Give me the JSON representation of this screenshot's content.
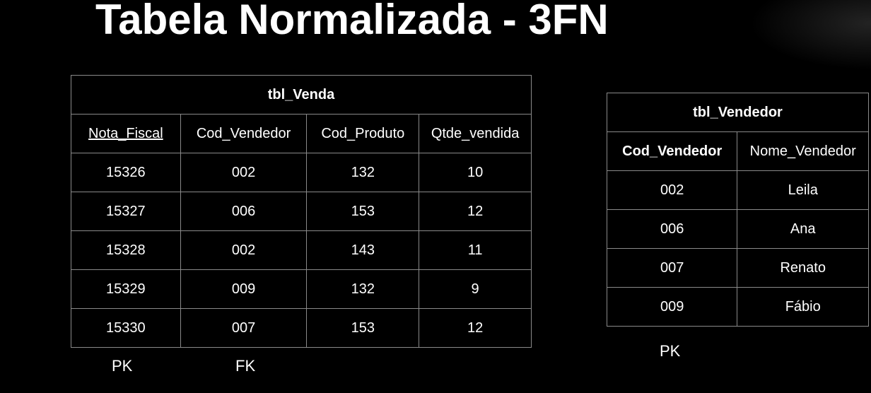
{
  "slide": {
    "title": "Tabela Normalizada - 3FN"
  },
  "tbl_venda": {
    "name": "tbl_Venda",
    "columns": [
      "Nota_Fiscal",
      "Cod_Vendedor",
      "Cod_Produto",
      "Qtde_vendida"
    ],
    "rows": [
      [
        "15326",
        "002",
        "132",
        "10"
      ],
      [
        "15327",
        "006",
        "153",
        "12"
      ],
      [
        "15328",
        "002",
        "143",
        "11"
      ],
      [
        "15329",
        "009",
        "132",
        "9"
      ],
      [
        "15330",
        "007",
        "153",
        "12"
      ]
    ],
    "pk_label": "PK",
    "fk_label": "FK"
  },
  "tbl_vendedor": {
    "name": "tbl_Vendedor",
    "columns": [
      "Cod_Vendedor",
      "Nome_Vendedor"
    ],
    "rows": [
      [
        "002",
        "Leila"
      ],
      [
        "006",
        "Ana"
      ],
      [
        "007",
        "Renato"
      ],
      [
        "009",
        "Fábio"
      ]
    ],
    "pk_label": "PK"
  }
}
